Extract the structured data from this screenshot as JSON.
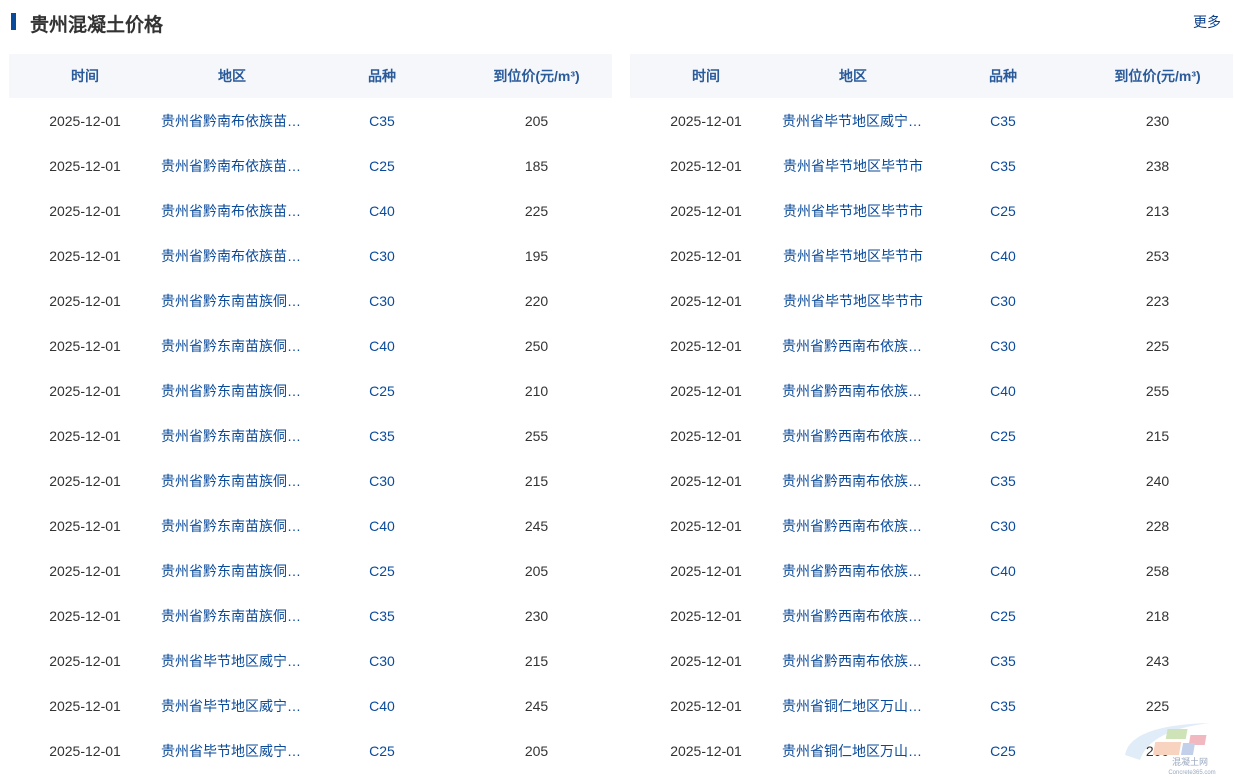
{
  "title": "贵州混凝土价格",
  "more": "更多",
  "headers": [
    "时间",
    "地区",
    "品种",
    "到位价(元/m³)"
  ],
  "watermark": {
    "text_cn": "混凝土网",
    "text_en": "Concrete365.com"
  },
  "left_rows": [
    [
      "2025-12-01",
      "贵州省黔南布依族苗族...",
      "C35",
      "205"
    ],
    [
      "2025-12-01",
      "贵州省黔南布依族苗族...",
      "C25",
      "185"
    ],
    [
      "2025-12-01",
      "贵州省黔南布依族苗族...",
      "C40",
      "225"
    ],
    [
      "2025-12-01",
      "贵州省黔南布依族苗族...",
      "C30",
      "195"
    ],
    [
      "2025-12-01",
      "贵州省黔东南苗族侗族...",
      "C30",
      "220"
    ],
    [
      "2025-12-01",
      "贵州省黔东南苗族侗族...",
      "C40",
      "250"
    ],
    [
      "2025-12-01",
      "贵州省黔东南苗族侗族...",
      "C25",
      "210"
    ],
    [
      "2025-12-01",
      "贵州省黔东南苗族侗族...",
      "C35",
      "255"
    ],
    [
      "2025-12-01",
      "贵州省黔东南苗族侗族...",
      "C30",
      "215"
    ],
    [
      "2025-12-01",
      "贵州省黔东南苗族侗族...",
      "C40",
      "245"
    ],
    [
      "2025-12-01",
      "贵州省黔东南苗族侗族...",
      "C25",
      "205"
    ],
    [
      "2025-12-01",
      "贵州省黔东南苗族侗族...",
      "C35",
      "230"
    ],
    [
      "2025-12-01",
      "贵州省毕节地区威宁彝...",
      "C30",
      "215"
    ],
    [
      "2025-12-01",
      "贵州省毕节地区威宁彝...",
      "C40",
      "245"
    ],
    [
      "2025-12-01",
      "贵州省毕节地区威宁彝...",
      "C25",
      "205"
    ]
  ],
  "right_rows": [
    [
      "2025-12-01",
      "贵州省毕节地区威宁彝...",
      "C35",
      "230"
    ],
    [
      "2025-12-01",
      "贵州省毕节地区毕节市",
      "C35",
      "238"
    ],
    [
      "2025-12-01",
      "贵州省毕节地区毕节市",
      "C25",
      "213"
    ],
    [
      "2025-12-01",
      "贵州省毕节地区毕节市",
      "C40",
      "253"
    ],
    [
      "2025-12-01",
      "贵州省毕节地区毕节市",
      "C30",
      "223"
    ],
    [
      "2025-12-01",
      "贵州省黔西南布依族苗...",
      "C30",
      "225"
    ],
    [
      "2025-12-01",
      "贵州省黔西南布依族苗...",
      "C40",
      "255"
    ],
    [
      "2025-12-01",
      "贵州省黔西南布依族苗...",
      "C25",
      "215"
    ],
    [
      "2025-12-01",
      "贵州省黔西南布依族苗...",
      "C35",
      "240"
    ],
    [
      "2025-12-01",
      "贵州省黔西南布依族苗...",
      "C30",
      "228"
    ],
    [
      "2025-12-01",
      "贵州省黔西南布依族苗...",
      "C40",
      "258"
    ],
    [
      "2025-12-01",
      "贵州省黔西南布依族苗...",
      "C25",
      "218"
    ],
    [
      "2025-12-01",
      "贵州省黔西南布依族苗...",
      "C35",
      "243"
    ],
    [
      "2025-12-01",
      "贵州省铜仁地区万山特区",
      "C35",
      "225"
    ],
    [
      "2025-12-01",
      "贵州省铜仁地区万山特区",
      "C25",
      "200"
    ]
  ]
}
